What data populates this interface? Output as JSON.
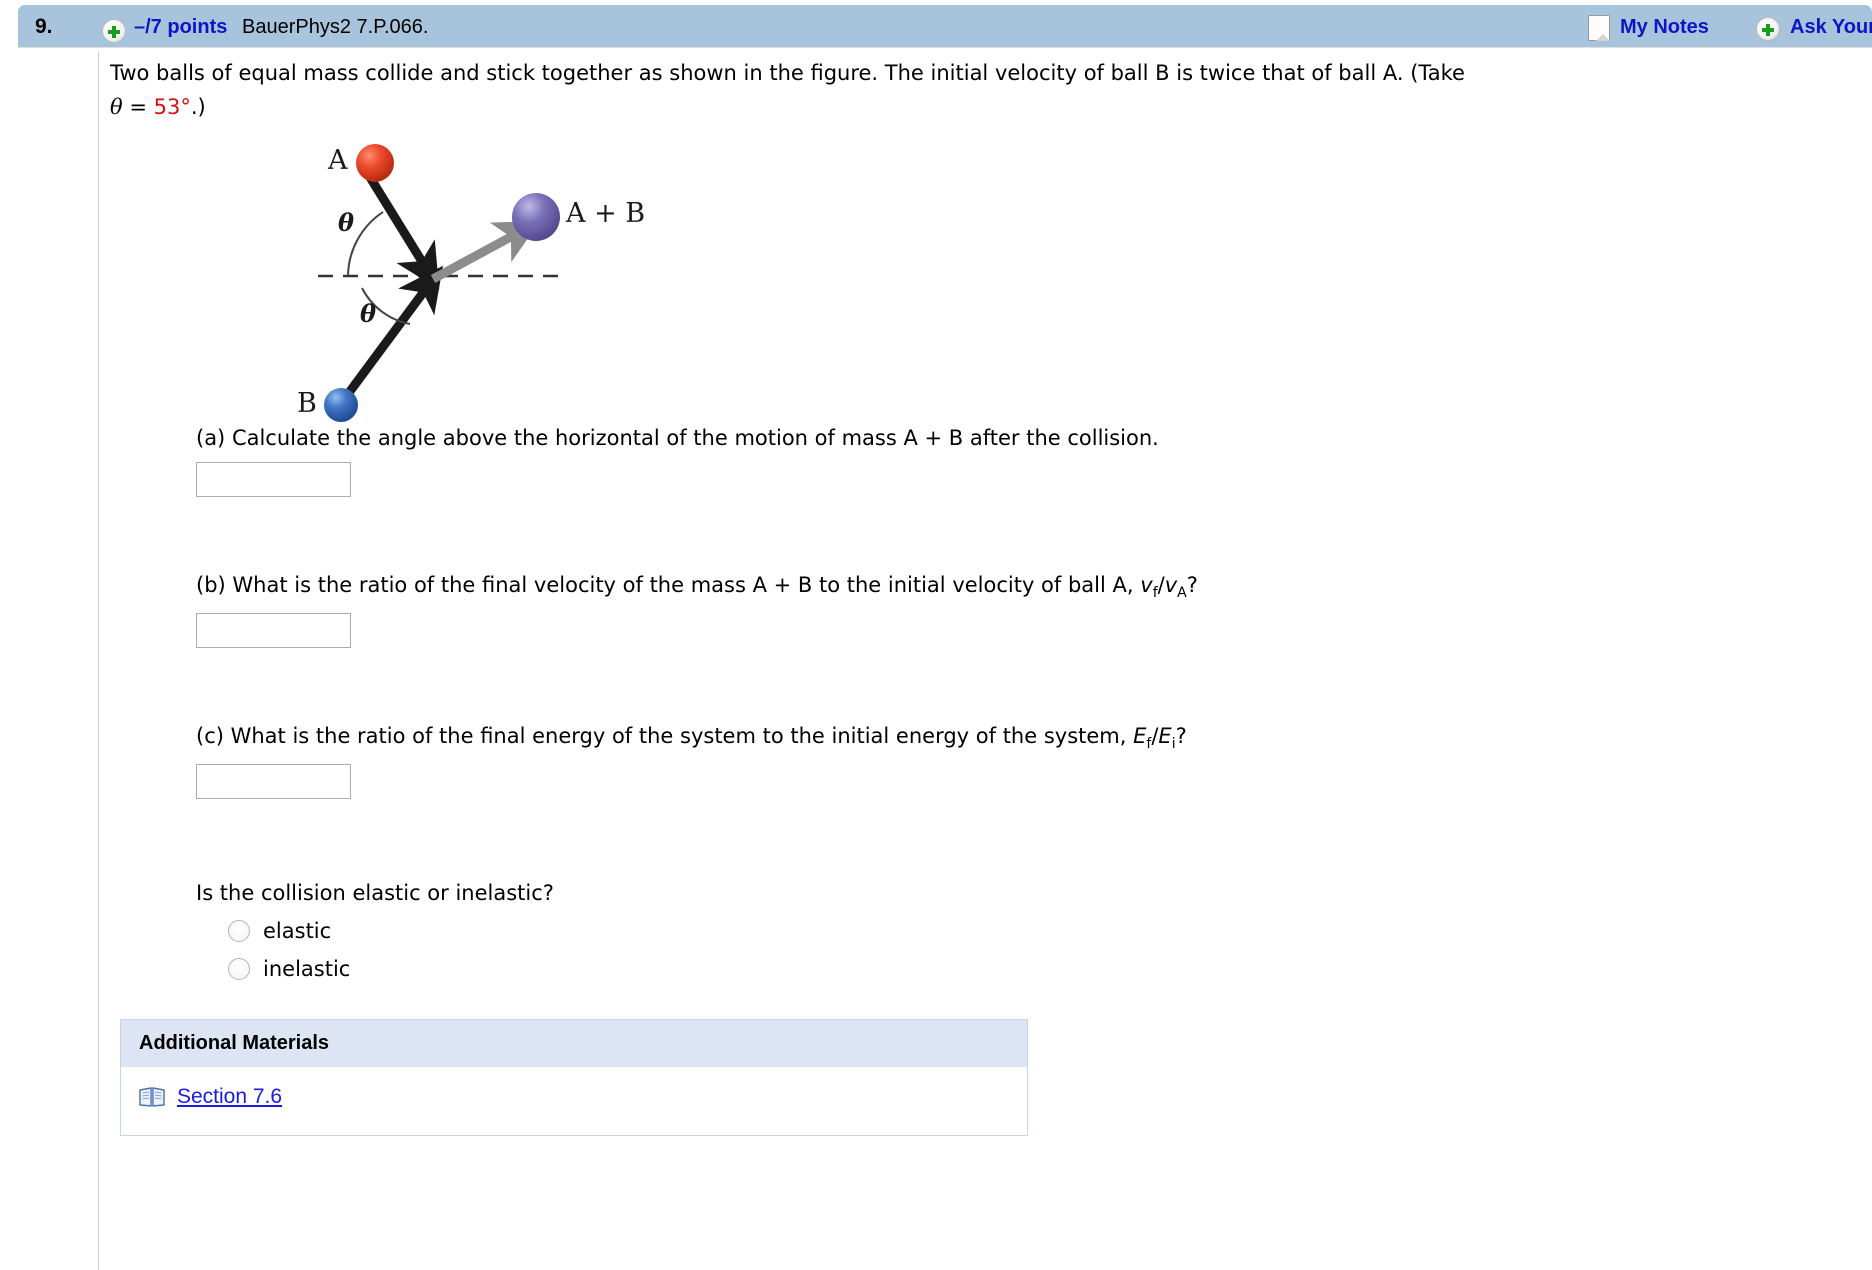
{
  "header": {
    "question_number": "9.",
    "points": "–/7 points",
    "question_code": "BauerPhys2 7.P.066.",
    "my_notes_label": "My Notes",
    "ask_your_label": "Ask Your",
    "plus_icon": "plus-circle-icon",
    "note_icon": "note-page-icon",
    "bar_color": "#a8c4dc",
    "link_color": "#1313c6"
  },
  "question": {
    "line1": "Two balls of equal mass collide and stick together as shown in the figure. The initial velocity of ball B is twice that of ball A. (Take",
    "theta_symbol": "θ",
    "equals": " = ",
    "theta_value": "53°",
    "line2_tail": ".)",
    "value_color": "#d61010"
  },
  "figure": {
    "label_a": "A",
    "label_b": "B",
    "label_ab": "A + B",
    "theta_upper": "θ",
    "theta_lower": "θ",
    "ball_a_color": "#e8402a",
    "ball_b_color": "#3f73c4",
    "ball_ab_color": "#7b71b8",
    "arrow_color": "#1a1a1a",
    "result_arrow_color": "#8c8c8c",
    "dashed_line_color": "#333333"
  },
  "parts": [
    {
      "id": "a",
      "prefix": "(a) ",
      "text": "Calculate the angle above the horizontal of the motion of mass A + B after the collision.",
      "answer_value": "",
      "answer_placeholder": ""
    },
    {
      "id": "b",
      "prefix": "(b) ",
      "text": "What is the ratio of the final velocity of the mass A + B to the initial velocity of ball A, ",
      "formula": "vf/vA?",
      "answer_value": "",
      "answer_placeholder": ""
    },
    {
      "id": "c",
      "prefix": "(c) ",
      "text": "What is the ratio of the final energy of the system to the initial energy of the system, ",
      "formula": "Ef/Ei?",
      "answer_value": "",
      "answer_placeholder": ""
    }
  ],
  "formula_b": {
    "v1": "v",
    "sub1": "f",
    "slash": "/",
    "v2": "v",
    "sub2": "A",
    "q": "?"
  },
  "formula_c": {
    "e1": "E",
    "sub1": "f",
    "slash": "/",
    "e2": "E",
    "sub2": "i",
    "q": "?"
  },
  "elastic_question": {
    "prompt": "Is the collision elastic or inelastic?",
    "options": [
      {
        "label": "elastic",
        "selected": false
      },
      {
        "label": "inelastic",
        "selected": false
      }
    ]
  },
  "additional_materials": {
    "title": "Additional Materials",
    "icon": "book-icon",
    "link_label": "Section 7.6",
    "link_color": "#1a1ae0",
    "header_bg": "#dde4f4"
  }
}
